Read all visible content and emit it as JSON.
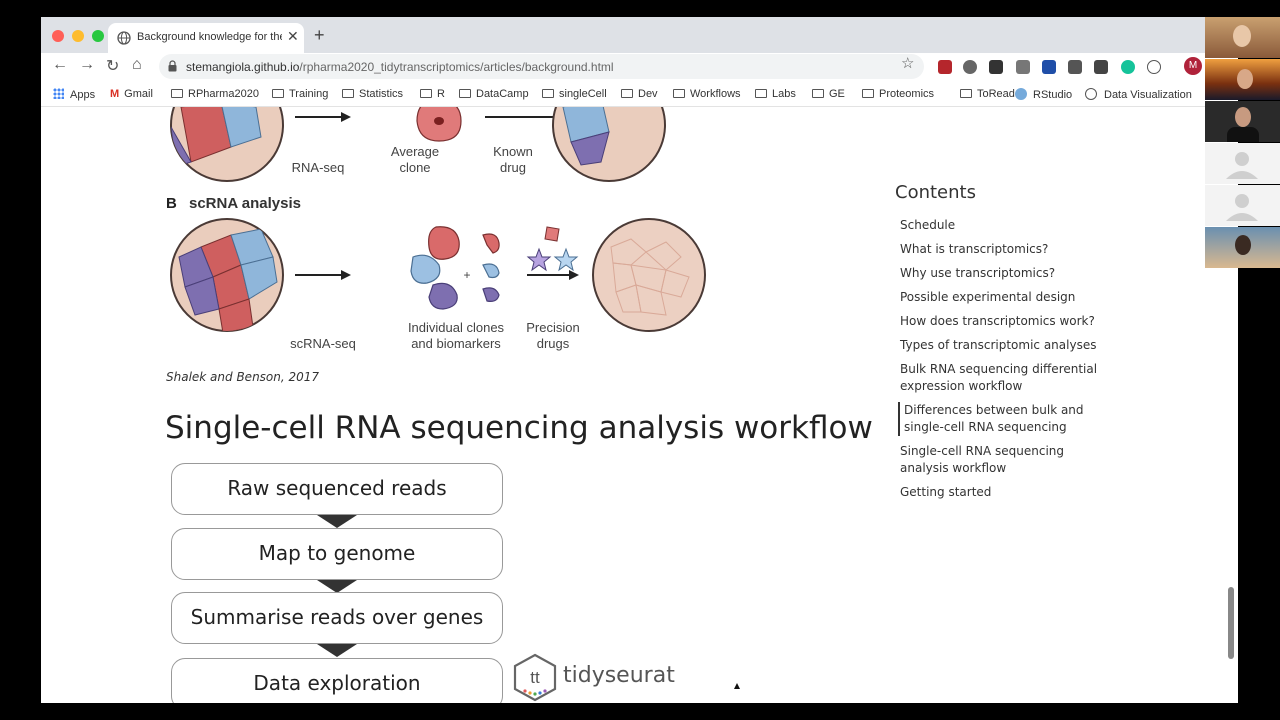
{
  "browser": {
    "tab": {
      "title": "Background knowledge for the"
    },
    "url": {
      "domain": "stemangiola.github.io",
      "path": "/rpharma2020_tidytranscriptomics/articles/background.html"
    },
    "profile_initial": "M",
    "bookmarks": [
      "Apps",
      "Gmail",
      "RPharma2020",
      "Training",
      "Statistics",
      "R",
      "DataCamp",
      "singleCell",
      "Dev",
      "Workflows",
      "Labs",
      "GE",
      "Proteomics",
      "ToRead",
      "RStudio",
      "Data Visualization"
    ]
  },
  "figure": {
    "rnaseq_label": "RNA-seq",
    "average_clone": [
      "Average",
      "clone"
    ],
    "known_drug": [
      "Known",
      "drug"
    ],
    "panel_b_letter": "B",
    "panel_b_title": "scRNA analysis",
    "scrnaseq_label": "scRNA-seq",
    "individual_clones": [
      "Individual clones",
      "and biomarkers"
    ],
    "precision_drugs": [
      "Precision",
      "drugs"
    ],
    "plus": "+"
  },
  "caption": "Shalek and Benson, 2017",
  "section_heading": "Single-cell RNA sequencing analysis workflow",
  "workflow": {
    "steps": [
      "Raw sequenced reads",
      "Map to genome",
      "Summarise reads over genes",
      "Data exploration"
    ],
    "logo_text": "tidyseurat",
    "logo_mark": "tt"
  },
  "toc": {
    "title": "Contents",
    "items": [
      "Schedule",
      "What is transcriptomics?",
      "Why use transcriptomics?",
      "Possible experimental design",
      "How does transcriptomics work?",
      "Types of transcriptomic analyses",
      "Bulk RNA sequencing differential expression workflow",
      "Differences between bulk and single-cell RNA sequencing",
      "Single-cell RNA sequencing analysis workflow",
      "Getting started"
    ],
    "active_index": 7
  },
  "colors": {
    "tumor_fill": "#eacdbd",
    "red_cell": "#cf5f5f",
    "blue_cell": "#8fb6da",
    "purple_cell": "#7e6fb0",
    "profile": "#b0223a"
  }
}
